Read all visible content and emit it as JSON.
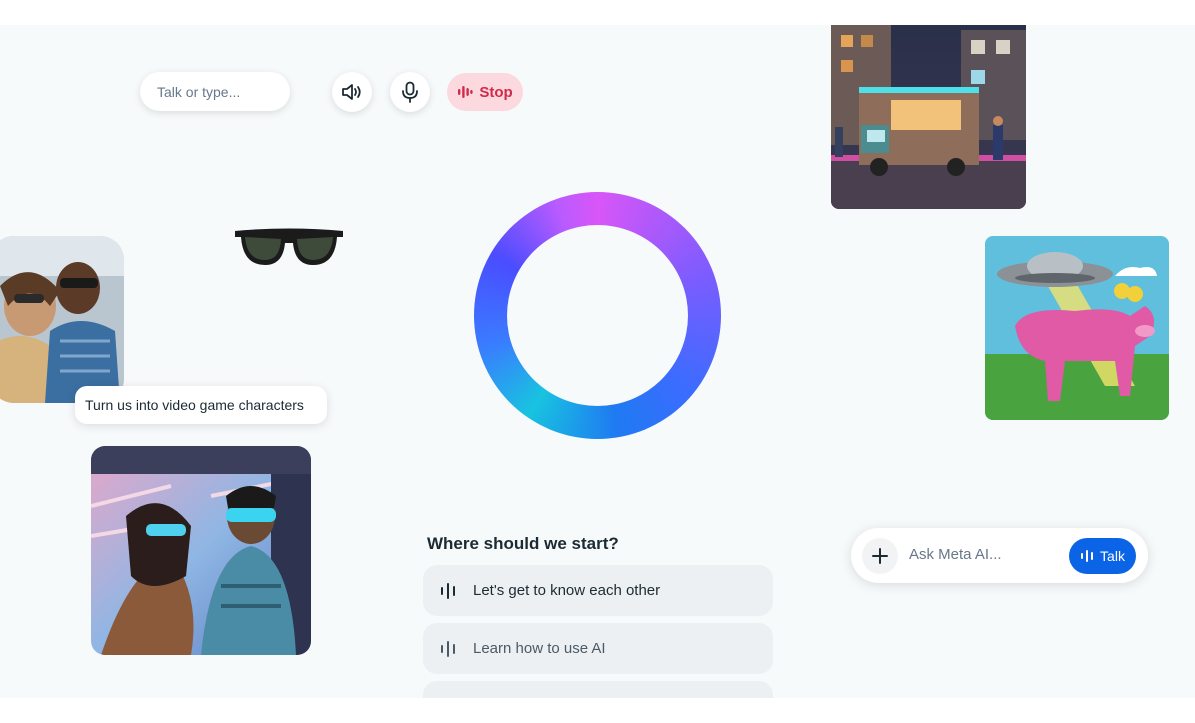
{
  "top_controls": {
    "input_placeholder": "Talk or type...",
    "speaker_icon": "speaker-icon",
    "mic_icon": "microphone-icon",
    "stop_label": "Stop"
  },
  "caption": "Turn us into video game characters",
  "suggestions": {
    "title": "Where should we start?",
    "items": [
      {
        "label": "Let's get to know each other",
        "icon": "voice-wave-icon"
      },
      {
        "label": "Learn how to use AI",
        "icon": "voice-wave-icon"
      },
      {
        "label": "",
        "icon": "voice-wave-icon"
      }
    ]
  },
  "ask_bar": {
    "placeholder": "Ask Meta AI...",
    "plus_icon": "plus-icon",
    "talk_label": "Talk"
  },
  "colors": {
    "accent": "#0a64e5",
    "stop_bg": "#fbd9df",
    "stop_text": "#d12a4b",
    "canvas_bg": "#f7fafb"
  }
}
